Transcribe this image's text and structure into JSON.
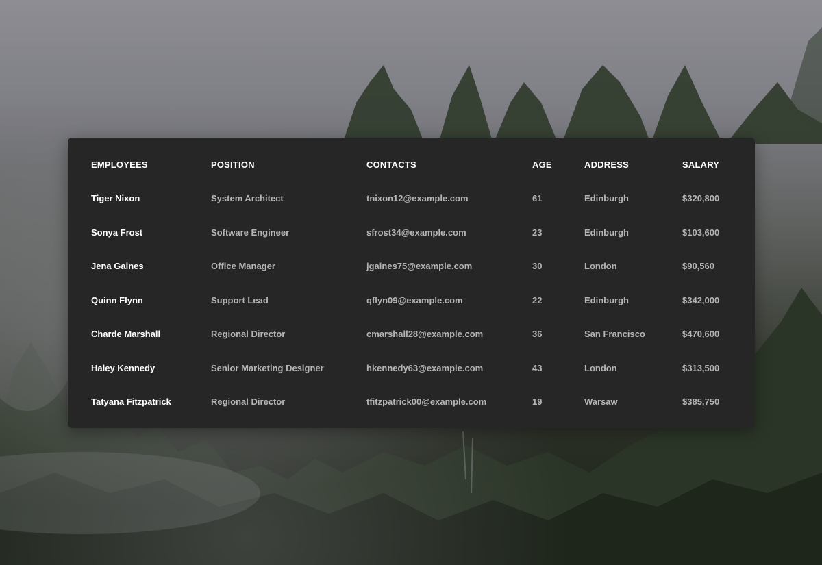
{
  "table": {
    "headers": [
      "EMPLOYEES",
      "POSITION",
      "CONTACTS",
      "AGE",
      "ADDRESS",
      "SALARY"
    ],
    "rows": [
      {
        "name": "Tiger Nixon",
        "position": "System Architect",
        "contact": "tnixon12@example.com",
        "age": "61",
        "address": "Edinburgh",
        "salary": "$320,800"
      },
      {
        "name": "Sonya Frost",
        "position": "Software Engineer",
        "contact": "sfrost34@example.com",
        "age": "23",
        "address": "Edinburgh",
        "salary": "$103,600"
      },
      {
        "name": "Jena Gaines",
        "position": "Office Manager",
        "contact": "jgaines75@example.com",
        "age": "30",
        "address": "London",
        "salary": "$90,560"
      },
      {
        "name": "Quinn Flynn",
        "position": "Support Lead",
        "contact": "qflyn09@example.com",
        "age": "22",
        "address": "Edinburgh",
        "salary": "$342,000"
      },
      {
        "name": "Charde Marshall",
        "position": "Regional Director",
        "contact": "cmarshall28@example.com",
        "age": "36",
        "address": "San Francisco",
        "salary": "$470,600"
      },
      {
        "name": "Haley Kennedy",
        "position": "Senior Marketing Designer",
        "contact": "hkennedy63@example.com",
        "age": "43",
        "address": "London",
        "salary": "$313,500"
      },
      {
        "name": "Tatyana Fitzpatrick",
        "position": "Regional Director",
        "contact": "tfitzpatrick00@example.com",
        "age": "19",
        "address": "Warsaw",
        "salary": "$385,750"
      }
    ]
  },
  "colors": {
    "card_background": "#262626",
    "header_text": "#ffffff",
    "name_text": "#ffffff",
    "cell_text": "#b4b4b4"
  }
}
